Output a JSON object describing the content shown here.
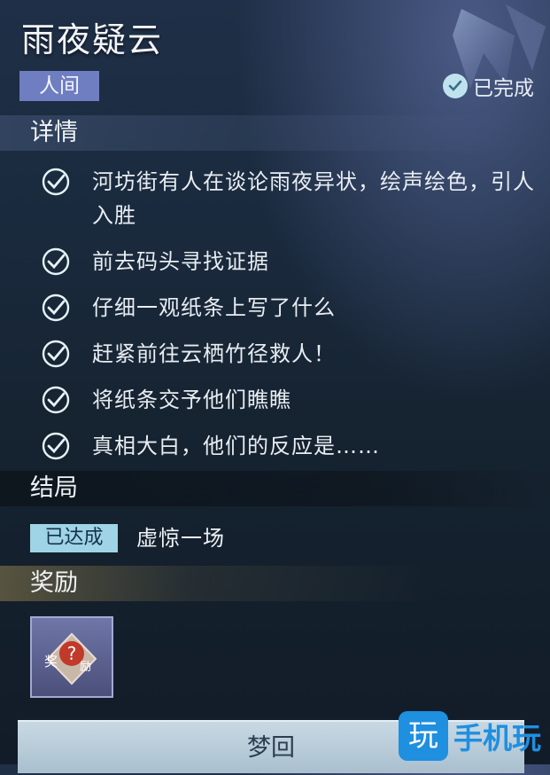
{
  "header": {
    "title": "雨夜疑云",
    "region_tag": "人间",
    "status": "已完成"
  },
  "detail": {
    "heading": "详情",
    "tasks": [
      {
        "text": "河坊街有人在谈论雨夜异状，绘声绘色，引人入胜",
        "done": true
      },
      {
        "text": "前去码头寻找证据",
        "done": true
      },
      {
        "text": "仔细一观纸条上写了什么",
        "done": true
      },
      {
        "text": "赶紧前往云栖竹径救人！",
        "done": true
      },
      {
        "text": "将纸条交予他们瞧瞧",
        "done": true
      },
      {
        "text": "真相大白，他们的反应是……",
        "done": true
      }
    ]
  },
  "ending": {
    "heading": "结局",
    "badge": "已达成",
    "text": "虚惊一场"
  },
  "reward": {
    "heading": "奖励",
    "item_label": "奖",
    "item_label_2": "励"
  },
  "footer": {
    "button_label": "梦回",
    "watermark_logo": "玩",
    "watermark_text": "手机玩"
  },
  "colors": {
    "accent_check": "#bfe2ef",
    "region_tag_bg": "#6f7ec1",
    "ending_badge_bg": "#9fd3e6",
    "reward_header_gold": "#d4b460",
    "watermark_blue": "#1f8fe0"
  }
}
